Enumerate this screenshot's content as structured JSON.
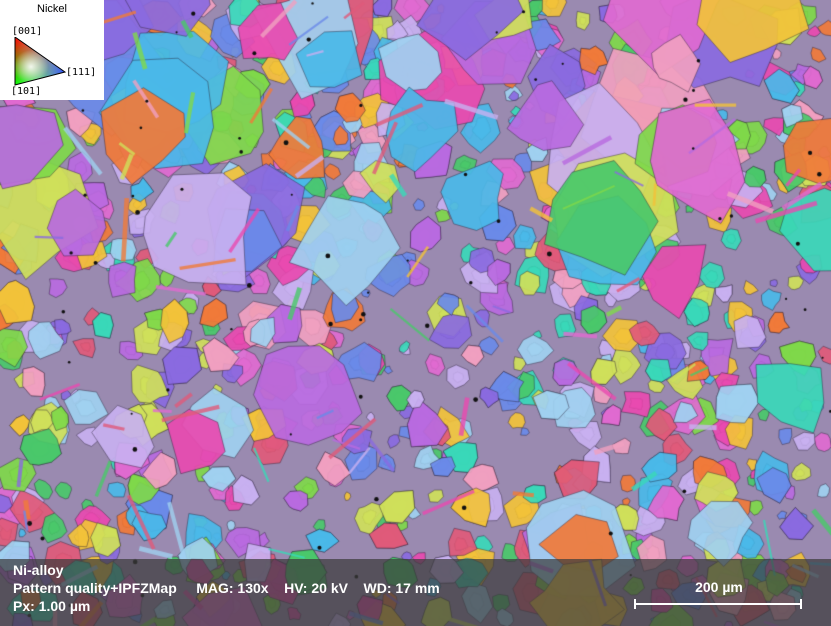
{
  "legend": {
    "title": "Nickel",
    "labels": {
      "top": "[001]",
      "bottom": "[101]",
      "right": "[111]"
    }
  },
  "info": {
    "sample": "Ni-alloy",
    "map_type": "Pattern quality+IPFZMap",
    "mag": "MAG: 130x",
    "hv": "HV: 20 kV",
    "wd": "WD: 17 mm",
    "px": "Px: 1.00 µm"
  },
  "scale_bar": {
    "label": "200 µm"
  },
  "colors": {
    "info_bar": "#3c3c3c",
    "grain_palette": [
      "#e05a7a",
      "#f07a3a",
      "#f2c23a",
      "#cfe05a",
      "#7fd84a",
      "#4ac86a",
      "#3ad8b8",
      "#4ab8e8",
      "#6a8ae8",
      "#8a6ae0",
      "#b86ae0",
      "#e06ad0",
      "#e84ab0",
      "#f0a0c0",
      "#a0d0f0",
      "#c8b0f0"
    ]
  }
}
